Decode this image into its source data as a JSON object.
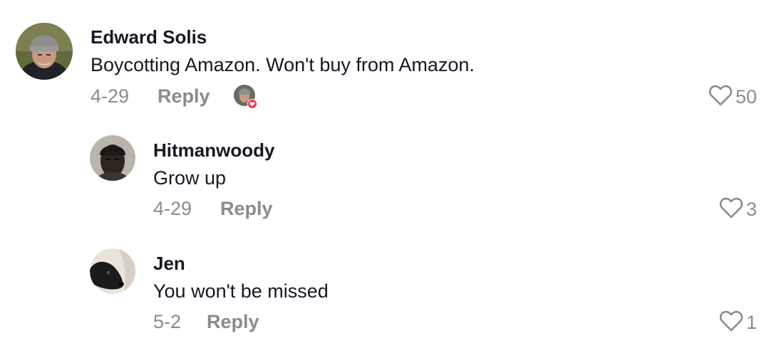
{
  "comments": [
    {
      "username": "Edward Solis",
      "text": "Boycotting Amazon. Won't buy from Amazon.",
      "date": "4-29",
      "reply_label": "Reply",
      "likes": "50",
      "creator_liked": true
    },
    {
      "username": "Hitmanwoody",
      "text": "Grow up",
      "date": "4-29",
      "reply_label": "Reply",
      "likes": "3"
    },
    {
      "username": "Jen",
      "text": "You won't be missed",
      "date": "5-2",
      "reply_label": "Reply",
      "likes": "1"
    }
  ],
  "colors": {
    "text": "#161823",
    "muted": "#8a8b91",
    "heart_badge": "#fe2c55"
  },
  "icons": [
    "heart-outline-icon",
    "creator-liked-heart-icon"
  ]
}
